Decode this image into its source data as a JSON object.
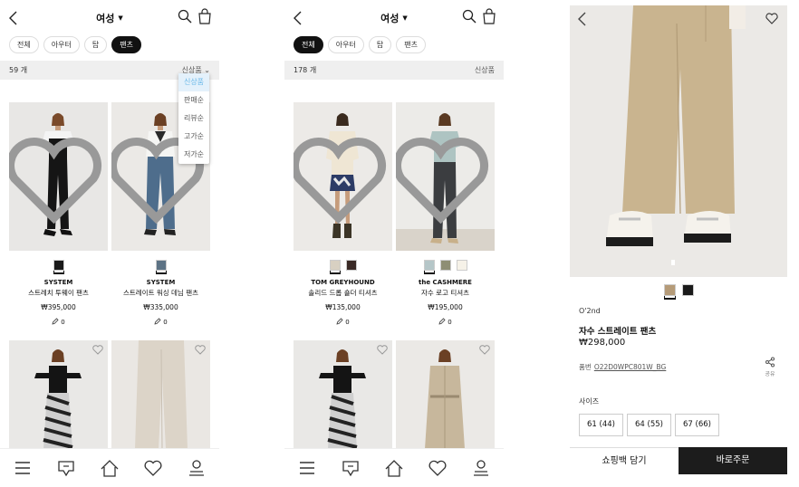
{
  "list_screen_1": {
    "title": "여성",
    "chips": [
      {
        "label": "전체"
      },
      {
        "label": "아우터"
      },
      {
        "label": "탑"
      },
      {
        "label": "팬츠",
        "active": true
      }
    ],
    "count": "59 개",
    "sort": "신상품",
    "sort_options": [
      "신상품",
      "판매순",
      "리뷰순",
      "고가순",
      "저가순"
    ],
    "products": [
      {
        "brand": "SYSTEM",
        "name": "스트레치 투웨이 팬츠",
        "price": "₩395,000",
        "reviews": "0",
        "swatches": [
          "#1a1a1a"
        ]
      },
      {
        "brand": "SYSTEM",
        "name": "스트레이트 워싱 데님 팬츠",
        "price": "₩335,000",
        "reviews": "0",
        "swatches": [
          "#5d7385"
        ]
      }
    ]
  },
  "list_screen_2": {
    "title": "여성",
    "chips": [
      {
        "label": "전체",
        "active": true
      },
      {
        "label": "아우터"
      },
      {
        "label": "탑"
      },
      {
        "label": "팬츠"
      }
    ],
    "count": "178 개",
    "sort": "신상품",
    "products": [
      {
        "brand": "TOM GREYHOUND",
        "name": "솔리드 드롭 숄더 티셔츠",
        "price": "₩135,000",
        "reviews": "0",
        "swatches": [
          "#d8d0c2",
          "#3a2a26"
        ]
      },
      {
        "brand": "the CASHMERE",
        "name": "자수 로고 티셔츠",
        "price": "₩195,000",
        "reviews": "0",
        "swatches": [
          "#b5c6c8",
          "#8e8e74",
          "#f6f2e8"
        ]
      }
    ]
  },
  "detail_screen": {
    "swatches": [
      "#b59b78",
      "#1a1a1a"
    ],
    "brand": "O'2nd",
    "name": "자수 스트레이트 팬츠",
    "price": "₩298,000",
    "code_label": "품번",
    "code": "O22D0WPC801W_BG",
    "share_label": "공유",
    "size_label": "사이즈",
    "sizes": [
      "61 (44)",
      "64 (55)",
      "67 (66)"
    ],
    "bag_button": "쇼핑백 담기",
    "buy_button": "바로주문"
  },
  "colors": {
    "accent": "#111111",
    "selected_sort": "#6ab8e8",
    "panel": "#efefef"
  }
}
